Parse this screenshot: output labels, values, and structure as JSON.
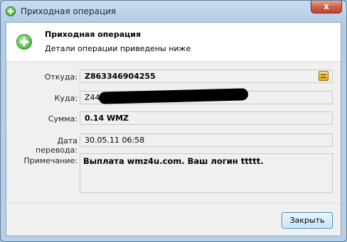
{
  "window": {
    "title": "Приходная операция",
    "close_label": "x"
  },
  "header": {
    "title": "Приходная операция",
    "subtitle": "Детали операции приведены ниже"
  },
  "fields": {
    "from_label": "Откуда:",
    "from_value": "Z863346904255",
    "to_label": "Куда:",
    "to_value": "Z44",
    "amount_label": "Сумма:",
    "amount_value": "0.14 WMZ",
    "date_label": "Дата перевода:",
    "date_value": "30.05.11 06:58",
    "note_label": "Примечание:",
    "note_value": "Выплата wmz4u.com. Ваш логин ttttt."
  },
  "buttons": {
    "close_label": "Закрыть"
  },
  "icons": {
    "title": "add-green-circle-icon",
    "header": "add-green-circle-icon",
    "purse": "purse-icon"
  },
  "colors": {
    "accent_green": "#34a828",
    "titlebar": "#b4cde6",
    "close_button": "#c0432d"
  }
}
